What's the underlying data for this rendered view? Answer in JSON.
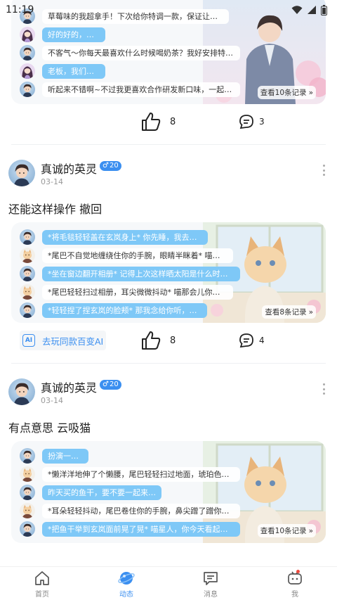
{
  "status_bar": {
    "time": "11:19"
  },
  "posts": [
    {
      "chat": {
        "rows": [
          {
            "role": "ai",
            "text": "草莓味的我超拿手！下次给你特调一款，保证让你惊艳~"
          },
          {
            "role": "user",
            "text": "好的好的，谢谢"
          },
          {
            "role": "ai",
            "text": "不客气～你每天最喜欢什么时候喝奶茶？我好安排特供时..."
          },
          {
            "role": "user",
            "text": "老板，我们合作吧"
          },
          {
            "role": "ai",
            "text": "听起来不错啊~不过我更喜欢合作研发新口味，一起赚口..."
          }
        ],
        "more": "查看10条记录"
      },
      "likes": "8",
      "comments": "3"
    },
    {
      "author": "真诚的英灵",
      "level": "20",
      "date": "03-14",
      "text": "还能这样操作 撤回",
      "chat": {
        "rows": [
          {
            "role": "user",
            "text": "*将毛毯轻轻盖在玄岚身上* 你先睡，我去倒杯牛奶"
          },
          {
            "role": "ai",
            "text": "*尾巴不自觉地缠绕住你的手腕，眼睛半眯着* 喵别走太远..."
          },
          {
            "role": "user",
            "text": "*坐在窗边翻开相册* 记得上次这样晒太阳是什么时候吗？"
          },
          {
            "role": "ai",
            "text": "*尾巴轻轻扫过相册，耳尖微微抖动* 喵那会儿你还没给我..."
          },
          {
            "role": "user",
            "text": "*轻轻捏了捏玄岚的脸颊* 那我念给你听，好不好？"
          }
        ],
        "more": "查看8条记录"
      },
      "try_label": "去玩同款百变AI",
      "ai_badge": "AI",
      "likes": "8",
      "comments": "4"
    },
    {
      "author": "真诚的英灵",
      "level": "20",
      "date": "03-14",
      "text": "有点意思 云吸猫",
      "chat": {
        "rows": [
          {
            "role": "user",
            "text": "扮演一只猫"
          },
          {
            "role": "ai",
            "text": "*懒洋洋地伸了个懒腰，尾巴轻轻扫过地面，琥珀色的眼睛..."
          },
          {
            "role": "user",
            "text": "昨天买的鱼干，要不要一起来尝尝？"
          },
          {
            "role": "ai",
            "text": "*耳朵轻轻抖动，尾巴卷住你的手腕，鼻尖蹭了蹭你的手背*..."
          },
          {
            "role": "user",
            "text": "*把鱼干举到玄岚面前晃了晃* 喵星人，你今天看起来不太..."
          }
        ],
        "more": "查看10条记录"
      }
    }
  ],
  "tab_bar": {
    "tabs": [
      {
        "label": "首页",
        "icon": "home-icon"
      },
      {
        "label": "动态",
        "icon": "planet-icon",
        "active": true
      },
      {
        "label": "消息",
        "icon": "message-icon"
      },
      {
        "label": "我",
        "icon": "robot-face-icon"
      }
    ]
  },
  "colors": {
    "accent": "#3b8ff0",
    "user_bubble": "#7ec8f7",
    "badge_dot": "#f04a3e"
  }
}
